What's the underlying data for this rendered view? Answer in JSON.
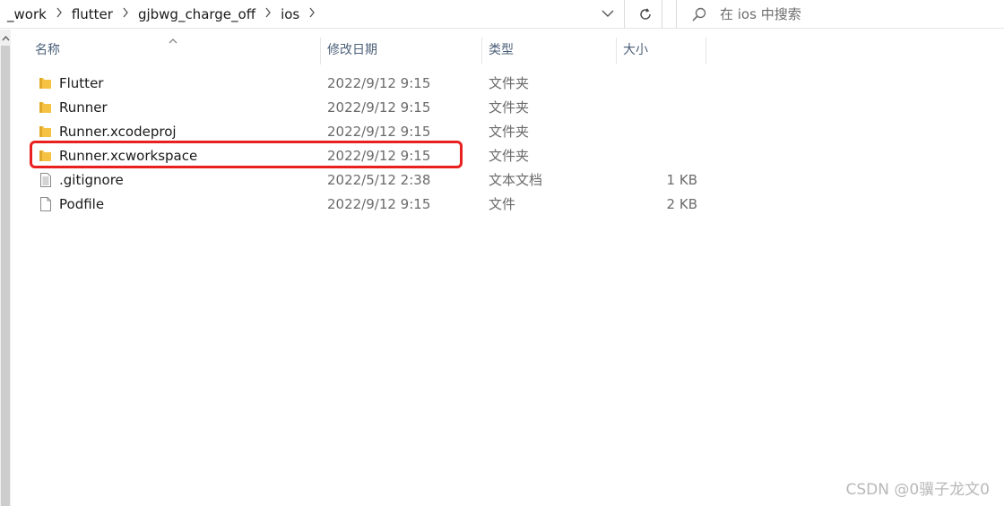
{
  "breadcrumb": {
    "items": [
      "_work",
      "flutter",
      "gjbwg_charge_off",
      "ios"
    ]
  },
  "search": {
    "placeholder": "在 ios 中搜索"
  },
  "columns": {
    "name": "名称",
    "modified": "修改日期",
    "type": "类型",
    "size": "大小"
  },
  "files": [
    {
      "name": "Flutter",
      "modified": "2022/9/12 9:15",
      "type": "文件夹",
      "size": "",
      "kind": "folder"
    },
    {
      "name": "Runner",
      "modified": "2022/9/12 9:15",
      "type": "文件夹",
      "size": "",
      "kind": "folder"
    },
    {
      "name": "Runner.xcodeproj",
      "modified": "2022/9/12 9:15",
      "type": "文件夹",
      "size": "",
      "kind": "folder"
    },
    {
      "name": "Runner.xcworkspace",
      "modified": "2022/9/12 9:15",
      "type": "文件夹",
      "size": "",
      "kind": "folder"
    },
    {
      "name": ".gitignore",
      "modified": "2022/5/12 2:38",
      "type": "文本文档",
      "size": "1 KB",
      "kind": "text"
    },
    {
      "name": "Podfile",
      "modified": "2022/9/12 9:15",
      "type": "文件",
      "size": "2 KB",
      "kind": "file"
    }
  ],
  "watermark": "CSDN @0骥子龙文0",
  "colors": {
    "folder": "#f5c244",
    "highlight": "#e8201e",
    "header_text": "#4c607a"
  }
}
